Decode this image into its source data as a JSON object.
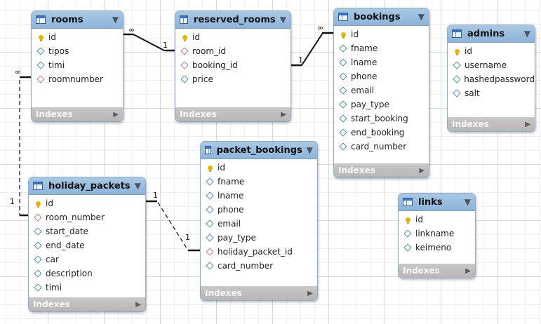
{
  "tables": {
    "rooms": {
      "title": "rooms",
      "columns": [
        {
          "name": "id",
          "kind": "key"
        },
        {
          "name": "tipos",
          "kind": "col"
        },
        {
          "name": "timi",
          "kind": "col"
        },
        {
          "name": "roomnumber",
          "kind": "fk"
        }
      ]
    },
    "reserved_rooms": {
      "title": "reserved_rooms",
      "columns": [
        {
          "name": "id",
          "kind": "key"
        },
        {
          "name": "room_id",
          "kind": "fk"
        },
        {
          "name": "booking_id",
          "kind": "fk"
        },
        {
          "name": "price",
          "kind": "col"
        }
      ]
    },
    "bookings": {
      "title": "bookings",
      "columns": [
        {
          "name": "id",
          "kind": "key"
        },
        {
          "name": "fname",
          "kind": "col"
        },
        {
          "name": "lname",
          "kind": "col"
        },
        {
          "name": "phone",
          "kind": "col"
        },
        {
          "name": "email",
          "kind": "col"
        },
        {
          "name": "pay_type",
          "kind": "col"
        },
        {
          "name": "start_booking",
          "kind": "col"
        },
        {
          "name": "end_booking",
          "kind": "col"
        },
        {
          "name": "card_number",
          "kind": "col"
        }
      ]
    },
    "admins": {
      "title": "admins",
      "columns": [
        {
          "name": "id",
          "kind": "key"
        },
        {
          "name": "username",
          "kind": "col"
        },
        {
          "name": "hashedpassword",
          "kind": "col"
        },
        {
          "name": "salt",
          "kind": "col"
        }
      ]
    },
    "packet_bookings": {
      "title": "packet_bookings",
      "columns": [
        {
          "name": "id",
          "kind": "key"
        },
        {
          "name": "fname",
          "kind": "col"
        },
        {
          "name": "lname",
          "kind": "col"
        },
        {
          "name": "phone",
          "kind": "col"
        },
        {
          "name": "email",
          "kind": "col"
        },
        {
          "name": "pay_type",
          "kind": "col"
        },
        {
          "name": "holiday_packet_id",
          "kind": "fk"
        },
        {
          "name": "card_number",
          "kind": "col"
        }
      ]
    },
    "holiday_packets": {
      "title": "holiday_packets",
      "columns": [
        {
          "name": "id",
          "kind": "key"
        },
        {
          "name": "room_number",
          "kind": "fk"
        },
        {
          "name": "start_date",
          "kind": "col"
        },
        {
          "name": "end_date",
          "kind": "col"
        },
        {
          "name": "car",
          "kind": "col"
        },
        {
          "name": "description",
          "kind": "col"
        },
        {
          "name": "timi",
          "kind": "col"
        }
      ]
    },
    "links": {
      "title": "links",
      "columns": [
        {
          "name": "id",
          "kind": "key"
        },
        {
          "name": "linkname",
          "kind": "col"
        },
        {
          "name": "keimeno",
          "kind": "col"
        }
      ]
    }
  },
  "footer_label": "Indexes",
  "relationships": [
    {
      "name": "rooms-reserved_rooms",
      "from_card": "∞",
      "to_card": "1"
    },
    {
      "name": "reserved_rooms-bookings",
      "from_card": "1",
      "to_card": "∞"
    },
    {
      "name": "rooms-holiday_packets",
      "from_card": "∞",
      "to_card": "1"
    },
    {
      "name": "holiday_packets-packet_bookings",
      "from_card": "1",
      "to_card": "1"
    }
  ],
  "colors": {
    "header": "#8db4da",
    "footer": "#b6b6b6",
    "key_icon": "#e8b400",
    "column_icon": "#4a8fb0",
    "fk_icon": "#c27a7a"
  }
}
